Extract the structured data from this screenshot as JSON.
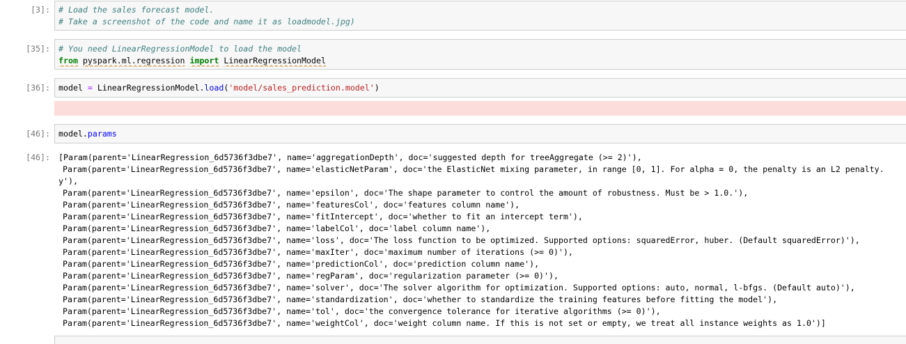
{
  "cells": [
    {
      "prompt": "[3]:",
      "lines": [
        "# Load the sales forecast model.",
        "# Take a screenshot of the code and name it as loadmodel.jpg)"
      ]
    },
    {
      "prompt": "[35]:",
      "comment": "# You need LinearRegressionModel to load the model",
      "import": {
        "from": "from",
        "module": "pyspark.ml.regression",
        "keyword": "import",
        "name": "LinearRegressionModel"
      }
    },
    {
      "prompt": "[36]:",
      "var": "model",
      "op": "=",
      "cls": "LinearRegressionModel.",
      "method": "load",
      "open": "(",
      "arg": "'model/sales_prediction.model'",
      "close": ")"
    },
    {
      "prompt": "[46]:",
      "obj": "model.",
      "attr": "params"
    }
  ],
  "output": {
    "prompt": "[46]:",
    "lines": [
      "[Param(parent='LinearRegression_6d5736f3dbe7', name='aggregationDepth', doc='suggested depth for treeAggregate (>= 2)'),",
      "Param(parent='LinearRegression_6d5736f3dbe7', name='elasticNetParam', doc='the ElasticNet mixing parameter, in range [0, 1]. For alpha = 0, the penalty is an L2 penalty.",
      "y'),",
      "Param(parent='LinearRegression_6d5736f3dbe7', name='epsilon', doc='The shape parameter to control the amount of robustness. Must be > 1.0.'),",
      "Param(parent='LinearRegression_6d5736f3dbe7', name='featuresCol', doc='features column name'),",
      "Param(parent='LinearRegression_6d5736f3dbe7', name='fitIntercept', doc='whether to fit an intercept term'),",
      "Param(parent='LinearRegression_6d5736f3dbe7', name='labelCol', doc='label column name'),",
      "Param(parent='LinearRegression_6d5736f3dbe7', name='loss', doc='The loss function to be optimized. Supported options: squaredError, huber. (Default squaredError)'),",
      "Param(parent='LinearRegression_6d5736f3dbe7', name='maxIter', doc='maximum number of iterations (>= 0)'),",
      "Param(parent='LinearRegression_6d5736f3dbe7', name='predictionCol', doc='prediction column name'),",
      "Param(parent='LinearRegression_6d5736f3dbe7', name='regParam', doc='regularization parameter (>= 0)'),",
      "Param(parent='LinearRegression_6d5736f3dbe7', name='solver', doc='The solver algorithm for optimization. Supported options: auto, normal, l-bfgs. (Default auto)'),",
      "Param(parent='LinearRegression_6d5736f3dbe7', name='standardization', doc='whether to standardize the training features before fitting the model'),",
      "Param(parent='LinearRegression_6d5736f3dbe7', name='tol', doc='the convergence tolerance for iterative algorithms (>= 0)'),",
      "Param(parent='LinearRegression_6d5736f3dbe7', name='weightCol', doc='weight column name. If this is not set or empty, we treat all instance weights as 1.0')]"
    ]
  },
  "colors": {
    "cell_background": "#f7f7f7",
    "cell_border": "#cfcfcf",
    "prompt": "#777777",
    "comment": "#408080",
    "keyword": "#008000",
    "string": "#BA2121",
    "property": "#0000FF",
    "error_background": "#fddcdc"
  }
}
